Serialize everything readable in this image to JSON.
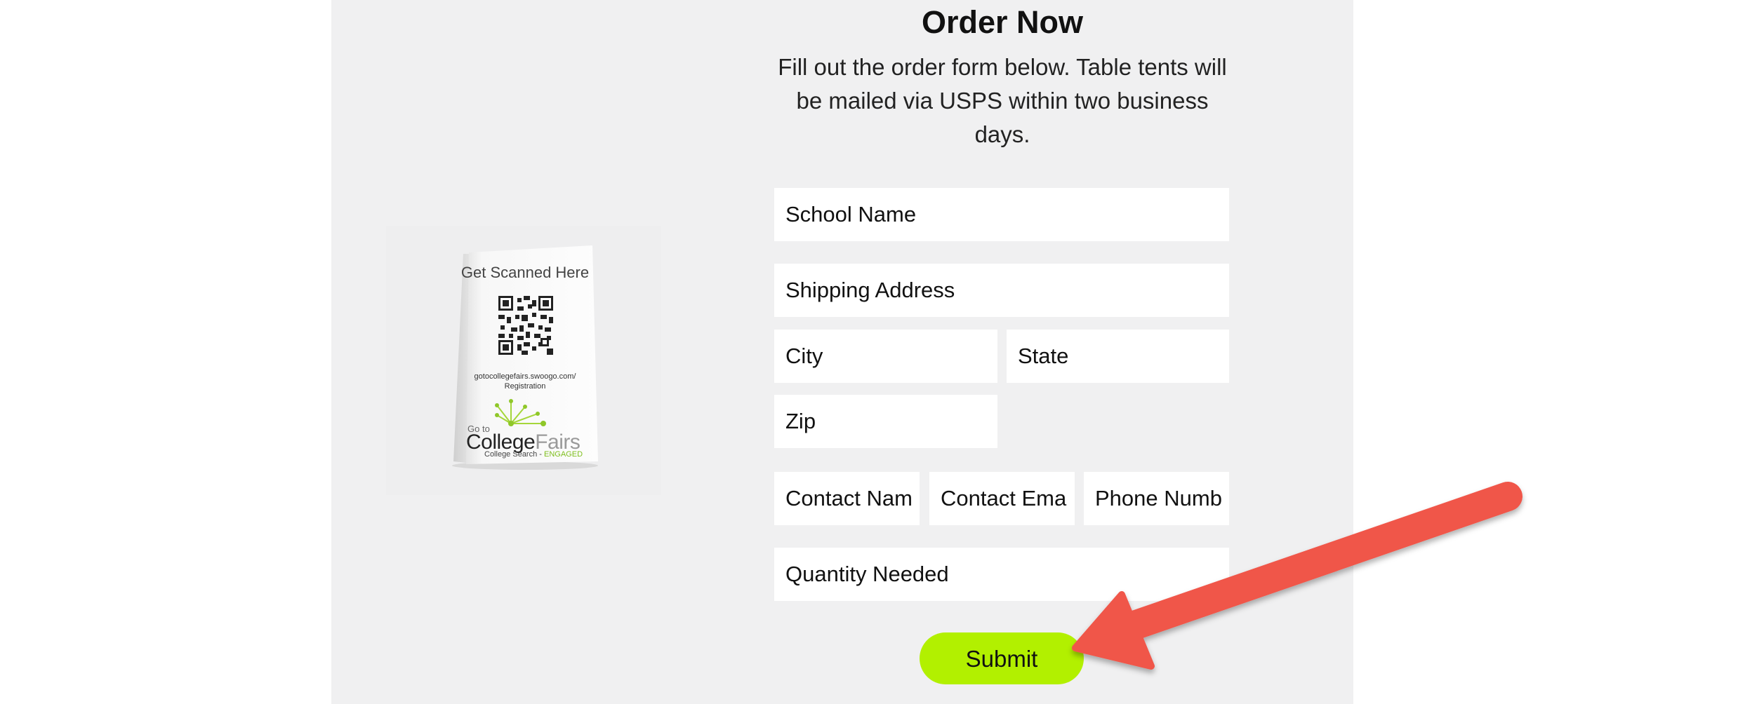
{
  "order": {
    "title": "Order Now",
    "subtitle": "Fill out the order form below. Table tents will be mailed via USPS within two business days."
  },
  "product": {
    "headline": "Get Scanned Here",
    "url_line1": "gotocollegefairs.swoogo.com/",
    "url_line2": "Registration",
    "brand_goto": "Go to",
    "brand_college": "College",
    "brand_fairs": "Fairs",
    "tagline": "College Search - ",
    "tagline_highlight": "ENGAGED"
  },
  "form": {
    "school_name": "School Name",
    "shipping_address": "Shipping Address",
    "city": "City",
    "state": "State",
    "zip": "Zip",
    "contact_name": "Contact Nam",
    "contact_email": "Contact Ema",
    "phone_number": "Phone Numb",
    "quantity": "Quantity Needed",
    "submit_label": "Submit"
  },
  "colors": {
    "panel": "#f0f0f1",
    "submit": "#b2f000",
    "arrow": "#f0564a",
    "brand_green": "#7dbe1b"
  },
  "icons": {
    "qr": "qr-code-icon",
    "arrow": "annotation-arrow-icon"
  }
}
